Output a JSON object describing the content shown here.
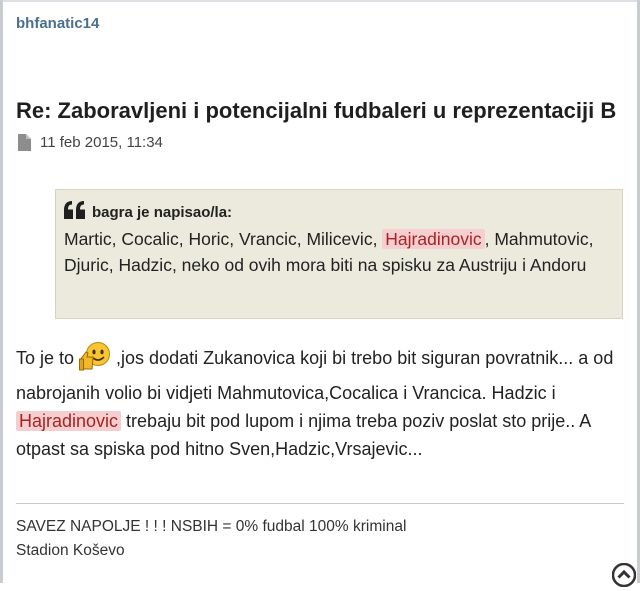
{
  "post": {
    "author": "bhfanatic14",
    "title": "Re: Zaboravljeni i potencijalni fudbaleri u reprezentaciji B",
    "date": "11 feb 2015, 11:34"
  },
  "quote": {
    "cite": "bagra je napisao/la:",
    "text_before": "Martic, Cocalic, Horic, Vrancic, Milicevic, ",
    "highlight": "Hajradinovic",
    "text_after": ", Mahmutovic, Djuric, Hadzic, neko od ovih mora biti na spisku za Austriju i Andoru"
  },
  "body": {
    "part1": "To je to ",
    "part2": " ,jos dodati Zukanovica koji bi trebo bit siguran povratnik... a od nabrojanih volio bi vidjeti Mahmutovica,Cocalica i Vrancica. Hadzic i ",
    "highlight": "Hajradinovic",
    "part3": " trebaju bit pod lupom i njima treba poziv poslat sto prije.. A otpast sa spiska pod hitno Sven,Hadzic,Vrsajevic..."
  },
  "signature": {
    "line1": "SAVEZ NAPOLJE ! ! ! NSBIH = 0% fudbal 100% kriminal",
    "line2": "Stadion Koševo"
  },
  "icons": {
    "date": "file-icon",
    "quote": "quote-icon",
    "smiley": "thumbs-up-smiley-icon",
    "top": "chevron-up-circle-icon"
  },
  "colors": {
    "author": "#4a6f8f",
    "quote_bg": "#ebeadd",
    "highlight_bg": "#f5cfcf",
    "highlight_text": "#a82323"
  }
}
